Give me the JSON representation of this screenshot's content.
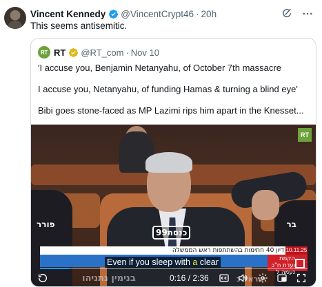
{
  "tweet": {
    "display_name": "Vincent Kennedy",
    "handle": "@VincentCrypt46",
    "separator": "·",
    "time": "20h",
    "text": "This seems antisemitic.",
    "verified_color": "#1d9bf0",
    "icons": [
      "grok-icon",
      "more-icon"
    ]
  },
  "quote": {
    "logo_text": "RT",
    "name": "RT",
    "handle": "@RT_com",
    "separator": "·",
    "date": "Nov 10",
    "paragraphs": [
      "'I accuse you, Benjamin Netanyahu, of October 7th massacre",
      "I accuse you, Netanyahu, of funding Hamas & turning a blind eye'",
      "Bibi goes stone-faced as MP Lazimi rips him apart in the Knesset..."
    ],
    "accent_color": "#6da23b"
  },
  "video": {
    "rt_badge": "RT",
    "hebrew_left": "פורר",
    "hebrew_right": "בר",
    "channel_logo": "כנסת99",
    "news_headline": "דיון 40 חתימות בהשתתפות ראש הממשלה",
    "news_date": "10.11.25",
    "news_red_text": "הקמת ועדת ח\"כ נעמה ל",
    "caption_before": "Even if you sleep with ",
    "caption_highlight": "a",
    "caption_after": " clear",
    "hebrew_bottom": "בנימין נתניהו",
    "hebrew_bottom_right": "ישראל כ",
    "progress_fraction": 0.11,
    "time_readout": "0:16 / 2:36",
    "progress_color": "#1d9bf0",
    "controls": [
      "rewind-icon",
      "captions-icon",
      "volume-icon",
      "settings-icon",
      "pip-icon",
      "fullscreen-icon"
    ]
  }
}
